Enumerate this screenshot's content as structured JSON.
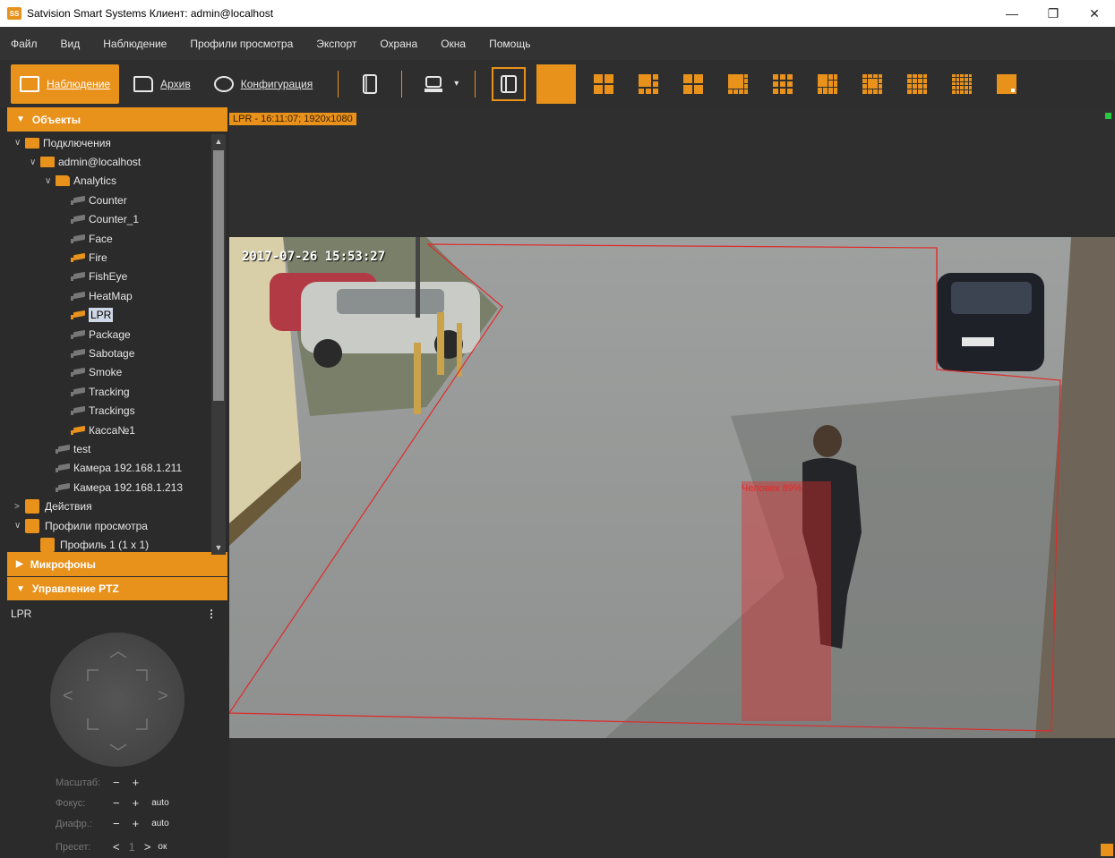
{
  "window": {
    "title": "Satvision Smart Systems Клиент: admin@localhost",
    "app_icon_text": "SS",
    "minimize": "—",
    "maximize": "❐",
    "close": "✕"
  },
  "menu": [
    "Файл",
    "Вид",
    "Наблюдение",
    "Профили просмотра",
    "Экспорт",
    "Охрана",
    "Окна",
    "Помощь"
  ],
  "toolbar": {
    "modes": [
      {
        "label": "Наблюдение",
        "active": true
      },
      {
        "label": "Архив",
        "active": false
      },
      {
        "label": "Конфигурация",
        "active": false
      }
    ],
    "dropdown_arrow": "▾"
  },
  "objects_panel": {
    "header": "Объекты",
    "tree": [
      {
        "label": "Подключения",
        "level": 0,
        "expander": "∨",
        "icon": "server"
      },
      {
        "label": "admin@localhost",
        "level": 1,
        "expander": "∨",
        "icon": "server"
      },
      {
        "label": "Analytics",
        "level": 2,
        "expander": "∨",
        "icon": "folder"
      },
      {
        "label": "Counter",
        "level": 3,
        "icon": "camera"
      },
      {
        "label": "Counter_1",
        "level": 3,
        "icon": "camera"
      },
      {
        "label": "Face",
        "level": 3,
        "icon": "camera"
      },
      {
        "label": "Fire",
        "level": 3,
        "icon": "camera-active"
      },
      {
        "label": "FishEye",
        "level": 3,
        "icon": "camera"
      },
      {
        "label": "HeatMap",
        "level": 3,
        "icon": "camera"
      },
      {
        "label": "LPR",
        "level": 3,
        "icon": "camera-active",
        "selected": true
      },
      {
        "label": "Package",
        "level": 3,
        "icon": "camera"
      },
      {
        "label": "Sabotage",
        "level": 3,
        "icon": "camera"
      },
      {
        "label": "Smoke",
        "level": 3,
        "icon": "camera"
      },
      {
        "label": "Tracking",
        "level": 3,
        "icon": "camera"
      },
      {
        "label": "Trackings",
        "level": 3,
        "icon": "camera"
      },
      {
        "label": "Касса№1",
        "level": 3,
        "icon": "camera-active"
      },
      {
        "label": "test",
        "level": 2,
        "icon": "camera"
      },
      {
        "label": "Камера 192.168.1.211",
        "level": 2,
        "icon": "camera"
      },
      {
        "label": "Камера 192.168.1.213",
        "level": 2,
        "icon": "camera"
      },
      {
        "label": "Действия",
        "level": 0,
        "expander": ">",
        "icon": "square"
      },
      {
        "label": "Профили просмотра",
        "level": 0,
        "expander": "∨",
        "icon": "square"
      },
      {
        "label": "Профиль 1 (1 x 1)",
        "level": 1,
        "icon": "square"
      }
    ]
  },
  "microphones_panel": {
    "header": "Микрофоны"
  },
  "ptz_panel": {
    "header": "Управление PTZ",
    "camera": "LPR",
    "menu_icon": "⋮",
    "zoom_label": "Масштаб:",
    "focus_label": "Фокус:",
    "iris_label": "Диафр.:",
    "preset_label": "Пресет:",
    "auto": "auto",
    "minus": "−",
    "plus": "+",
    "preset_prev": "<",
    "preset_value": "1",
    "preset_next": ">",
    "ok": "ок"
  },
  "video": {
    "label": "LPR - 16:11:07; 1920x1080",
    "timestamp": "2017-07-26 15:53:27",
    "detection_label": "Человек 89%"
  },
  "colors": {
    "accent": "#e8911b",
    "zone": "#e02a2a",
    "record": "#28c840"
  }
}
